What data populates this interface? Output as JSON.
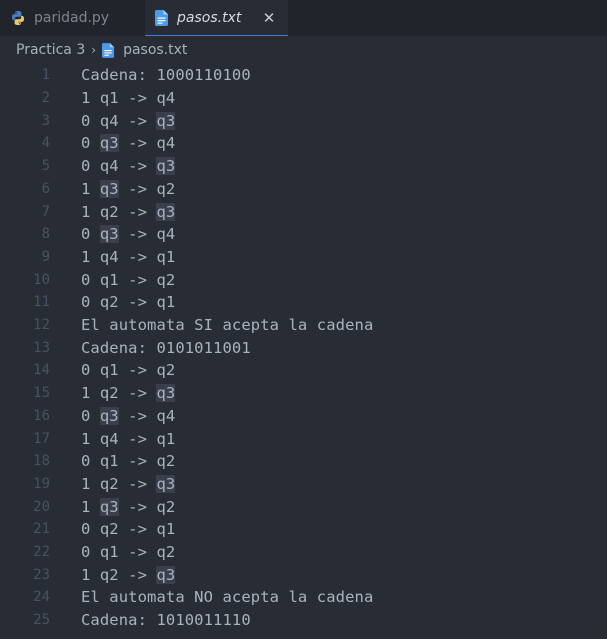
{
  "tabs": [
    {
      "label": "paridad.py",
      "icon": "python-icon",
      "active": false
    },
    {
      "label": "pasos.txt",
      "icon": "file-icon",
      "active": true,
      "close": "✕"
    }
  ],
  "breadcrumb": {
    "folder": "Practica 3",
    "separator": "›",
    "file": "pasos.txt"
  },
  "colors": {
    "background": "#282c34",
    "tabbar": "#21252b",
    "accent": "#4d78cc",
    "text": "#abb2bf",
    "gutter": "#495162",
    "highlight": "#3a3f4b"
  },
  "lines": [
    {
      "n": "1",
      "text": "Cadena: 1000110100"
    },
    {
      "n": "2",
      "text": "1 q1 -> q4"
    },
    {
      "n": "3",
      "text": "0 q4 -> q3"
    },
    {
      "n": "4",
      "text": "0 q3 -> q4"
    },
    {
      "n": "5",
      "text": "0 q4 -> q3"
    },
    {
      "n": "6",
      "text": "1 q3 -> q2"
    },
    {
      "n": "7",
      "text": "1 q2 -> q3"
    },
    {
      "n": "8",
      "text": "0 q3 -> q4"
    },
    {
      "n": "9",
      "text": "1 q4 -> q1"
    },
    {
      "n": "10",
      "text": "0 q1 -> q2"
    },
    {
      "n": "11",
      "text": "0 q2 -> q1"
    },
    {
      "n": "12",
      "text": "El automata SI acepta la cadena"
    },
    {
      "n": "13",
      "text": "Cadena: 0101011001"
    },
    {
      "n": "14",
      "text": "0 q1 -> q2"
    },
    {
      "n": "15",
      "text": "1 q2 -> q3"
    },
    {
      "n": "16",
      "text": "0 q3 -> q4"
    },
    {
      "n": "17",
      "text": "1 q4 -> q1"
    },
    {
      "n": "18",
      "text": "0 q1 -> q2"
    },
    {
      "n": "19",
      "text": "1 q2 -> q3"
    },
    {
      "n": "20",
      "text": "1 q3 -> q2"
    },
    {
      "n": "21",
      "text": "0 q2 -> q1"
    },
    {
      "n": "22",
      "text": "0 q1 -> q2"
    },
    {
      "n": "23",
      "text": "1 q2 -> q3"
    },
    {
      "n": "24",
      "text": "El automata NO acepta la cadena"
    },
    {
      "n": "25",
      "text": "Cadena: 1010011110"
    }
  ]
}
